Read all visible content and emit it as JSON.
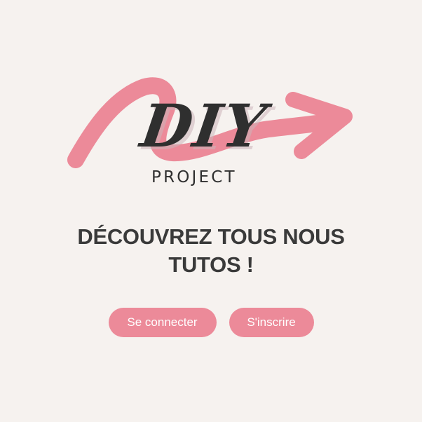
{
  "logo": {
    "main_text": "DIY",
    "sub_text": "PROJECT",
    "arrow_color": "#ec8a99",
    "text_color": "#2f2f2f"
  },
  "headline": {
    "line1": "DÉCOUVREZ TOUS NOUS",
    "line2": "TUTOS !"
  },
  "actions": {
    "login_label": "Se connecter",
    "signup_label": "S'inscrire"
  },
  "colors": {
    "background": "#f6f2ef",
    "accent": "#ec8a99",
    "heading": "#3a3a3a"
  }
}
